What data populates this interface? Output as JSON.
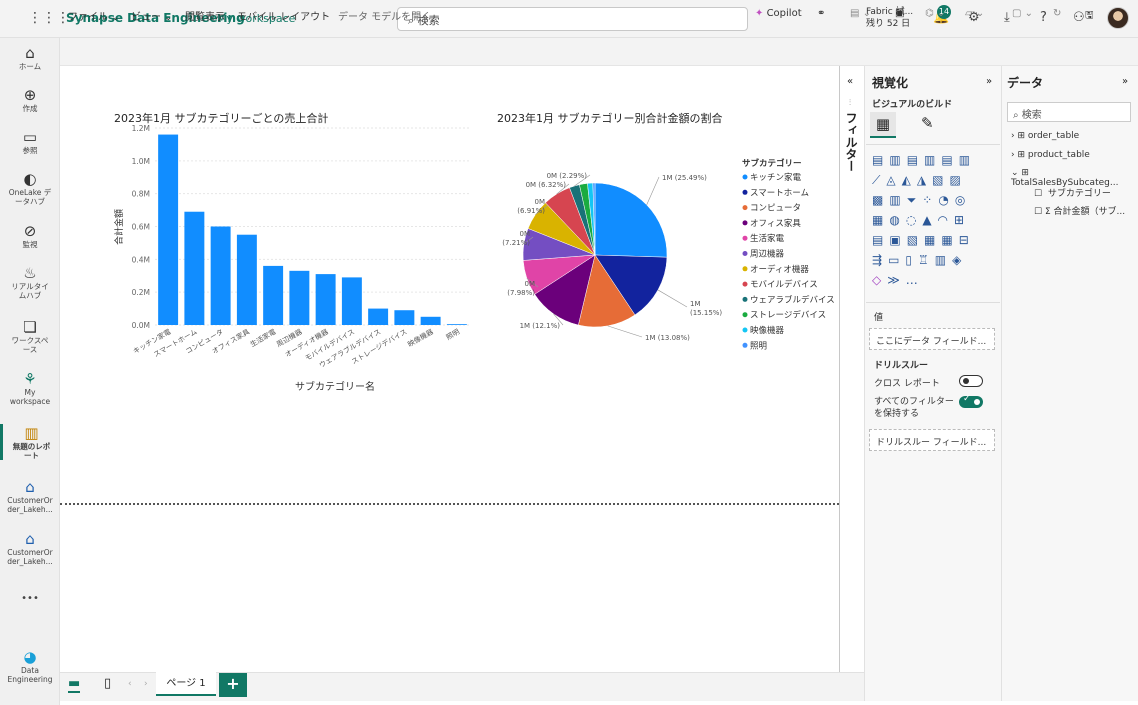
{
  "topbar": {
    "app_name": "Synapse Data Engineering",
    "workspace": "My workspace",
    "search_placeholder": "検索",
    "trial_line1": "Fabric 試...",
    "trial_line2": "残り 52 日",
    "notification_count": "14"
  },
  "nav": [
    {
      "label": "ホーム",
      "icon": "home-icon"
    },
    {
      "label": "作成",
      "icon": "plus-icon"
    },
    {
      "label": "参照",
      "icon": "folder-icon"
    },
    {
      "label": "OneLake デ\nータハブ",
      "icon": "onelake-icon"
    },
    {
      "label": "監視",
      "icon": "monitor-icon"
    },
    {
      "label": "リアルタイ\nムハブ",
      "icon": "realtime-icon"
    },
    {
      "label": "ワークスペ\nース",
      "icon": "workspace-icon"
    },
    {
      "label": "My\nworkspace",
      "icon": "myworkspace-icon"
    },
    {
      "label": "無題のレポ\nート",
      "icon": "report-icon"
    },
    {
      "label": "CustomerOr\nder_Lakeh...",
      "icon": "lakehouse-icon"
    },
    {
      "label": "CustomerOr\nder_Lakeh...",
      "icon": "lakehouse-icon"
    },
    {
      "label": "•••",
      "icon": "more-icon"
    },
    {
      "label": "Data\nEngineering",
      "icon": "data-engineering-icon"
    }
  ],
  "toolbar": {
    "file": "ファイル",
    "view": "ビュー",
    "reading": "閲覧表示",
    "mobile": "モバイル レイアウト",
    "open_model": "データ モデルを開く",
    "copilot": "Copilot"
  },
  "bar_chart_title": "2023年1月 サブカテゴリーごとの売上合計",
  "pie_chart_title": "2023年1月 サブカテゴリー別合計金額の割合",
  "chart_data": [
    {
      "type": "bar",
      "title": "2023年1月 サブカテゴリーごとの売上合計",
      "xlabel": "サブカテゴリー名",
      "ylabel": "合計金額",
      "ylim": [
        0,
        1.2
      ],
      "yticks": [
        "0.0M",
        "0.2M",
        "0.4M",
        "0.6M",
        "0.8M",
        "1.0M",
        "1.2M"
      ],
      "categories": [
        "キッチン家電",
        "スマートホーム",
        "コンピュータ",
        "オフィス家具",
        "生活家電",
        "周辺機器",
        "オーディオ機器",
        "モバイルデバイス",
        "ウェアラブルデバイス",
        "ストレージデバイス",
        "映像機器",
        "照明"
      ],
      "values": [
        1.16,
        0.69,
        0.6,
        0.55,
        0.36,
        0.33,
        0.31,
        0.29,
        0.1,
        0.09,
        0.05,
        0.005
      ],
      "color": "#118DFF",
      "grid": true
    },
    {
      "type": "pie",
      "title": "2023年1月 サブカテゴリー別合計金額の割合",
      "legend_title": "サブカテゴリー",
      "legend_position": "right",
      "slices": [
        {
          "name": "キッチン家電",
          "value": 25.49,
          "label": "1M (25.49%)",
          "color": "#118DFF"
        },
        {
          "name": "スマートホーム",
          "value": 15.15,
          "label": "1M\n(15.15%)",
          "color": "#12239E"
        },
        {
          "name": "コンピュータ",
          "value": 13.08,
          "label": "1M (13.08%)",
          "color": "#E66C37"
        },
        {
          "name": "オフィス家具",
          "value": 12.1,
          "label": "1M (12.1%)",
          "color": "#6B007B"
        },
        {
          "name": "生活家電",
          "value": 7.98,
          "label": "0M\n(7.98%)",
          "color": "#E044A7"
        },
        {
          "name": "周辺機器",
          "value": 7.21,
          "label": "0M\n(7.21%)",
          "color": "#744EC2"
        },
        {
          "name": "オーディオ機器",
          "value": 6.91,
          "label": "0M\n(6.91%)",
          "color": "#D9B300"
        },
        {
          "name": "モバイルデバイス",
          "value": 6.32,
          "label": "0M (6.32%)",
          "color": "#D64550"
        },
        {
          "name": "ウェアラブルデバイス",
          "value": 2.29,
          "label": "0M (2.29%)",
          "color": "#197278"
        },
        {
          "name": "ストレージデバイス",
          "value": 1.8,
          "label": "",
          "color": "#1AAB40"
        },
        {
          "name": "映像機器",
          "value": 1.2,
          "label": "",
          "color": "#15C6F4"
        },
        {
          "name": "照明",
          "value": 0.47,
          "label": "",
          "color": "#4092FF"
        }
      ]
    }
  ],
  "filters_label": "フィルター",
  "visualization": {
    "title": "視覚化",
    "build_label": "ビジュアルのビルド",
    "values_label": "値",
    "values_placeholder": "ここにデータ フィールド...",
    "drill_title": "ドリルスルー",
    "cross_report": "クロス レポート",
    "keep_filters": "すべてのフィルター\nを保持する",
    "drill_placeholder": "ドリルスルー フィールド..."
  },
  "data_pane": {
    "title": "データ",
    "search_placeholder": "検索",
    "tables": [
      "order_table",
      "product_table",
      "TotalSalesBySubcateg..."
    ],
    "fields": [
      "サブカテゴリー",
      "Σ 合計金額（サブ..."
    ]
  },
  "page_tab": "ページ 1",
  "add_page": "+"
}
